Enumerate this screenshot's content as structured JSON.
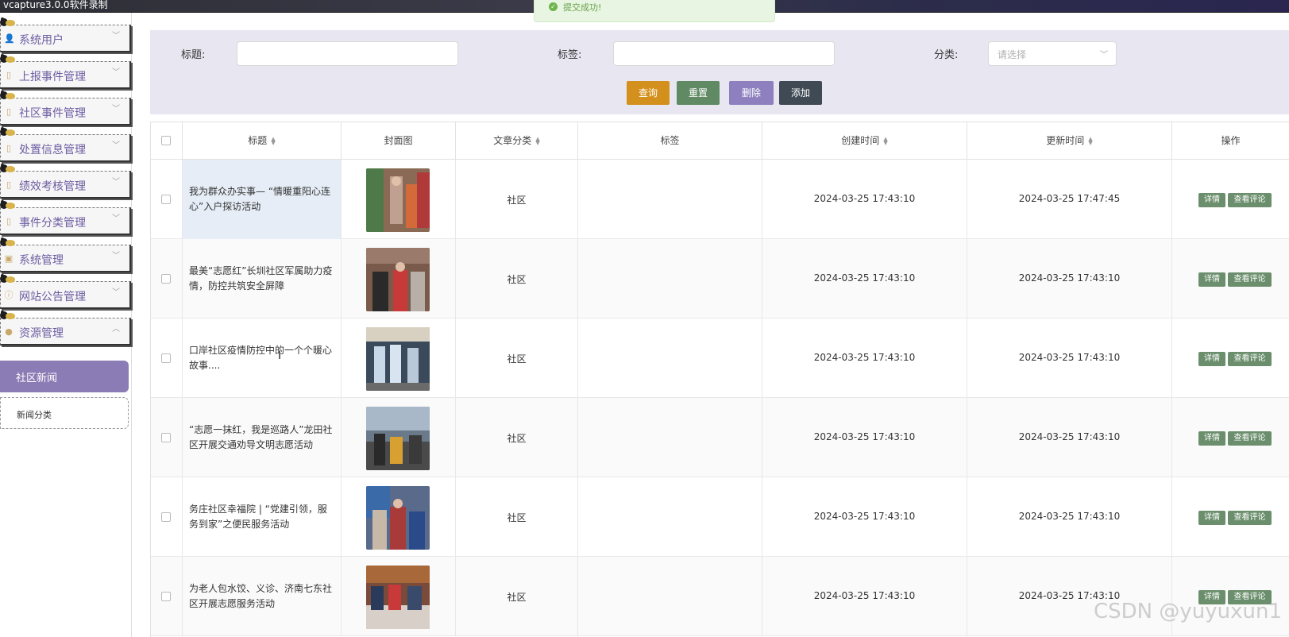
{
  "app": {
    "title": "vcapture3.0.0软件录制"
  },
  "toast": {
    "text": "提交成功!"
  },
  "sidebar": {
    "items": [
      {
        "label": "系统用户",
        "icon": "user-icon"
      },
      {
        "label": "上报事件管理",
        "icon": "document-icon"
      },
      {
        "label": "社区事件管理",
        "icon": "document-icon"
      },
      {
        "label": "处置信息管理",
        "icon": "document-icon"
      },
      {
        "label": "绩效考核管理",
        "icon": "document-icon"
      },
      {
        "label": "事件分类管理",
        "icon": "document-icon"
      },
      {
        "label": "系统管理",
        "icon": "image-icon"
      },
      {
        "label": "网站公告管理",
        "icon": "info-icon"
      },
      {
        "label": "资源管理",
        "icon": "bulb-icon"
      }
    ],
    "subitems": [
      {
        "label": "社区新闻"
      },
      {
        "label": "新闻分类"
      }
    ]
  },
  "search": {
    "title_label": "标题:",
    "tag_label": "标签:",
    "category_label": "分类:",
    "category_placeholder": "请选择",
    "buttons": {
      "query": "查询",
      "reset": "重置",
      "delete": "删除",
      "add": "添加"
    },
    "button_colors": {
      "query": "#d4901c",
      "reset": "#5f8a63",
      "delete": "#8e80bf",
      "add": "#3f4a55"
    }
  },
  "table": {
    "headers": {
      "title": "标题",
      "cover": "封面图",
      "category": "文章分类",
      "tags": "标签",
      "created": "创建时间",
      "updated": "更新时间",
      "actions": "操作"
    },
    "detail_label": "详情",
    "comments_label": "查看评论",
    "rows": [
      {
        "title": "我为群众办实事— “情暖重阳心连心”入户探访活动",
        "category": "社区",
        "tags": "",
        "created": "2024-03-25 17:43:10",
        "updated": "2024-03-25 17:47:45"
      },
      {
        "title": "最美“志愿红”长圳社区军属助力疫情，防控共筑安全屏障",
        "category": "社区",
        "tags": "",
        "created": "2024-03-25 17:43:10",
        "updated": "2024-03-25 17:43:10"
      },
      {
        "title": "口岸社区疫情防控中的一个个暖心故事....",
        "category": "社区",
        "tags": "",
        "created": "2024-03-25 17:43:10",
        "updated": "2024-03-25 17:43:10"
      },
      {
        "title": "“志愿一抹红，我是巡路人”龙田社区开展交通劝导文明志愿活动",
        "category": "社区",
        "tags": "",
        "created": "2024-03-25 17:43:10",
        "updated": "2024-03-25 17:43:10"
      },
      {
        "title": "务庄社区幸福院 | “党建引领，服务到家”之便民服务活动",
        "category": "社区",
        "tags": "",
        "created": "2024-03-25 17:43:10",
        "updated": "2024-03-25 17:43:10"
      },
      {
        "title": "为老人包水饺、义诊、济南七东社区开展志愿服务活动",
        "category": "社区",
        "tags": "",
        "created": "2024-03-25 17:43:10",
        "updated": "2024-03-25 17:43:10"
      }
    ]
  },
  "watermark": "CSDN @yuyuxun1"
}
